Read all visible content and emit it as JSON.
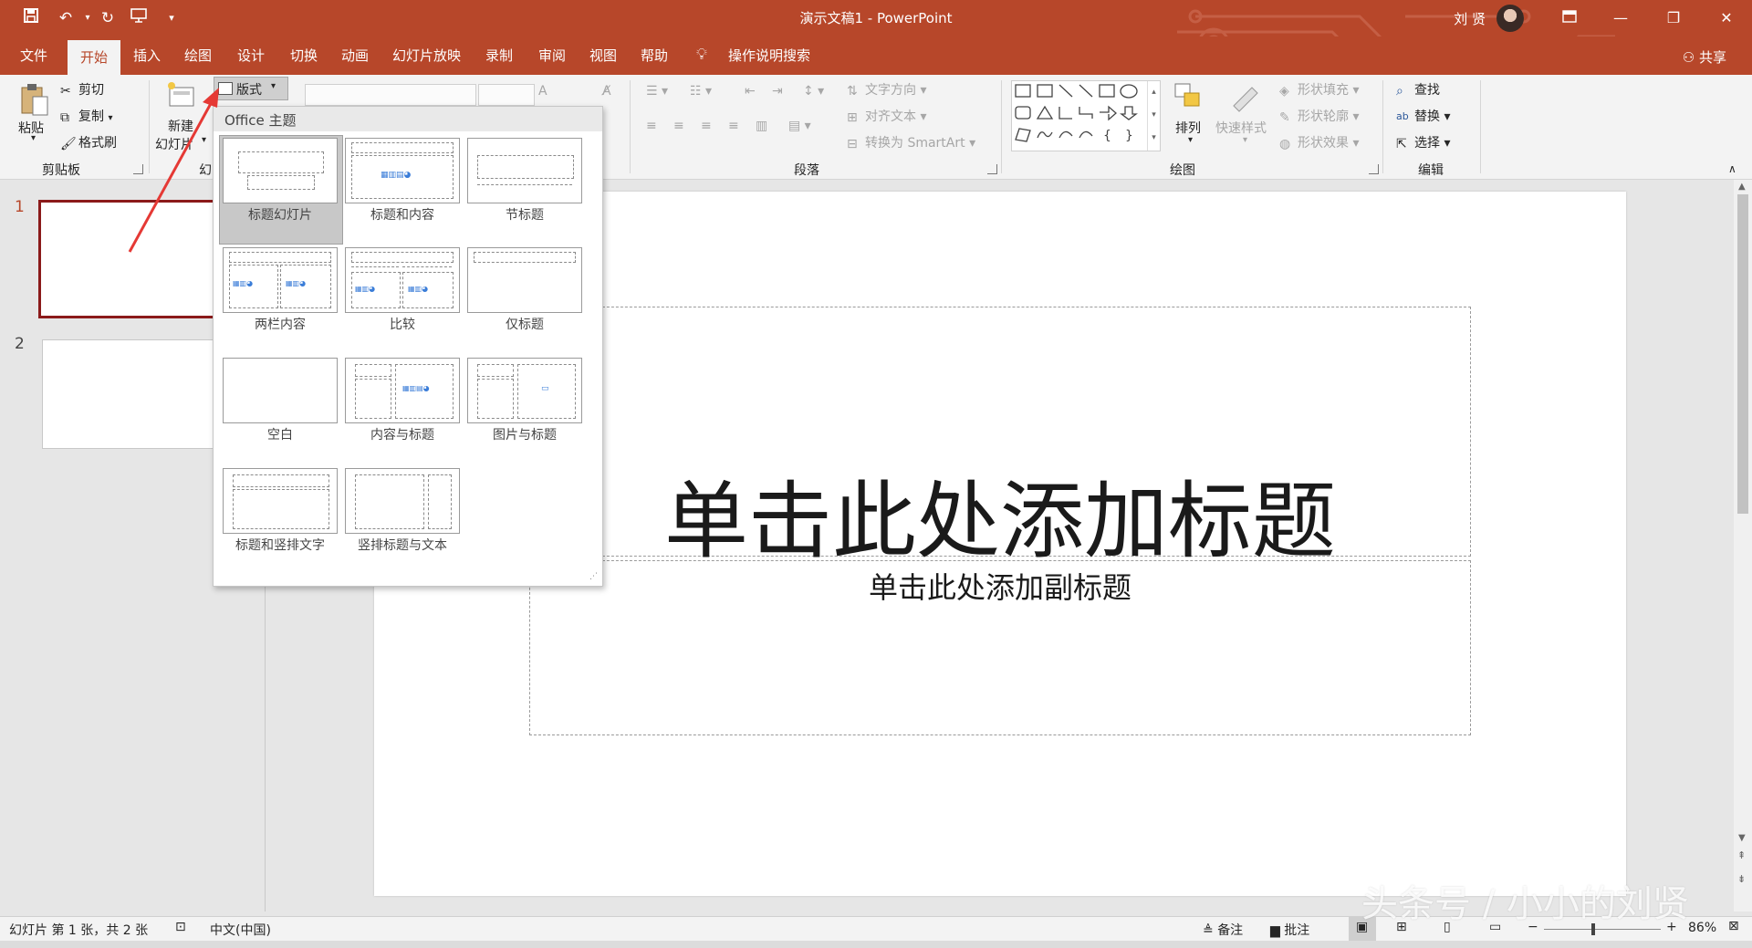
{
  "window": {
    "title": "演示文稿1 - PowerPoint",
    "user": "刘 贤",
    "accent": "#b7472a"
  },
  "quick_access": [
    "save-icon",
    "undo-icon",
    "redo-icon",
    "present-icon",
    "customize-icon"
  ],
  "tabs": [
    "文件",
    "开始",
    "插入",
    "绘图",
    "设计",
    "切换",
    "动画",
    "幻灯片放映",
    "录制",
    "审阅",
    "视图",
    "帮助",
    "操作说明搜索"
  ],
  "active_tab": "开始",
  "share_label": "共享",
  "ribbon": {
    "clipboard": {
      "paste": "粘贴",
      "cut": "剪切",
      "copy": "复制",
      "format_painter": "格式刷",
      "group": "剪贴板"
    },
    "slides": {
      "new_slide_1": "新建",
      "new_slide_2": "幻灯片",
      "layout": "版式",
      "group": "幻"
    },
    "paragraph": {
      "text_direction": "文字方向",
      "align_text": "对齐文本",
      "smartart": "转换为 SmartArt",
      "group": "段落"
    },
    "drawing": {
      "arrange": "排列",
      "quick_styles": "快速样式",
      "fill": "形状填充",
      "outline": "形状轮廓",
      "effects": "形状效果",
      "group": "绘图"
    },
    "editing": {
      "find": "查找",
      "replace": "替换",
      "select": "选择",
      "group": "编辑"
    }
  },
  "gallery": {
    "header": "Office 主题",
    "layouts": [
      "标题幻灯片",
      "标题和内容",
      "节标题",
      "两栏内容",
      "比较",
      "仅标题",
      "空白",
      "内容与标题",
      "图片与标题",
      "标题和竖排文字",
      "竖排标题与文本"
    ],
    "selected": "标题幻灯片"
  },
  "thumbnails": [
    "1",
    "2"
  ],
  "slide": {
    "title_placeholder": "单击此处添加标题",
    "subtitle_placeholder": "单击此处添加副标题"
  },
  "status": {
    "slide_info": "幻灯片 第 1 张，共 2 张",
    "language": "中文(中国)",
    "notes": "备注",
    "comments": "批注",
    "zoom": "86%",
    "zoom_level": 0.86
  },
  "watermark": "头条号 / 小小的刘贤"
}
